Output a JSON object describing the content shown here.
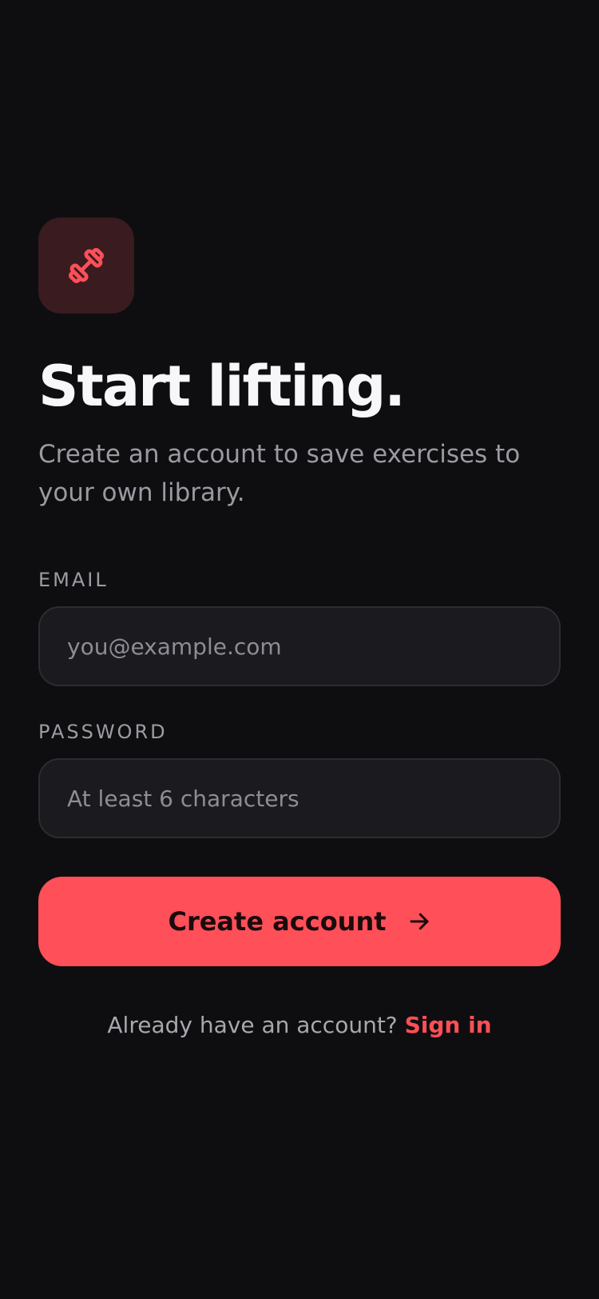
{
  "colors": {
    "background": "#0e0e10",
    "accent": "#ff4f58",
    "logo_tile": "#3a1b1f",
    "input_background": "#1b1a1e",
    "muted_text": "#9a9aa2"
  },
  "logo": {
    "icon": "dumbbell-icon"
  },
  "header": {
    "title": "Start lifting.",
    "subtitle": "Create an account to save exercises to your own library."
  },
  "form": {
    "email": {
      "label": "EMAIL",
      "value": "",
      "placeholder": "you@example.com"
    },
    "password": {
      "label": "PASSWORD",
      "value": "",
      "placeholder": "At least 6 characters"
    },
    "submit": {
      "label": "Create account",
      "icon": "arrow-right-icon"
    }
  },
  "footer": {
    "prompt": "Already have an account?",
    "link": "Sign in"
  }
}
